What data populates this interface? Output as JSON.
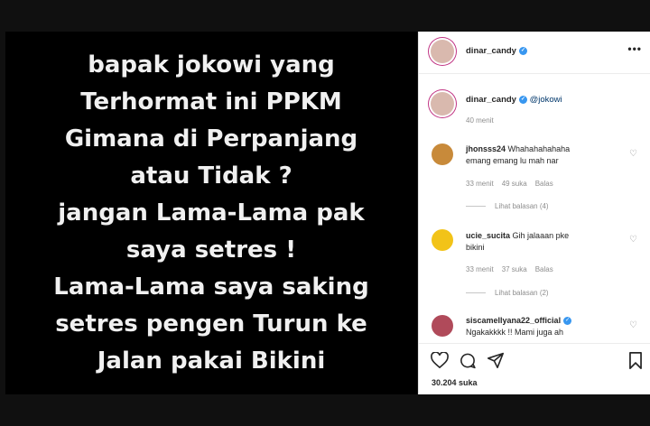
{
  "post_text": {
    "lines": [
      "bapak jokowi yang",
      "Terhormat ini PPKM",
      "Gimana di Perpanjang",
      "atau Tidak ?",
      "jangan Lama-Lama pak",
      "saya setres !",
      "Lama-Lama saya saking",
      "setres pengen Turun ke",
      "Jalan pakai Bikini"
    ]
  },
  "header": {
    "username": "dinar_candy",
    "more": "•••"
  },
  "caption": {
    "username": "dinar_candy",
    "mention": "@jokowi",
    "time": "40 menit"
  },
  "comments": [
    {
      "username": "jhonsss24",
      "text": "Whahahahahaha",
      "text2": "emang emang lu mah nar",
      "time": "33 menit",
      "likes": "49 suka",
      "reply": "Balas",
      "view_replies": "Lihat balasan (4)"
    },
    {
      "username": "ucie_sucita",
      "text": "Gih jalaaan pke",
      "text2": "bikini",
      "time": "33 menit",
      "likes": "37 suka",
      "reply": "Balas",
      "view_replies": "Lihat balasan (2)"
    },
    {
      "username": "siscamellyana22_official",
      "text2": "Ngakakkkk !! Mami juga ah"
    }
  ],
  "footer": {
    "likes": "30.204 suka"
  },
  "colors": {
    "verified": "#3897f0",
    "link": "#00376b",
    "muted": "#8e8e8e"
  }
}
